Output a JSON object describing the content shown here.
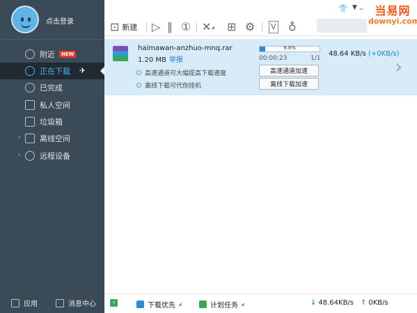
{
  "sidebar": {
    "login": "点击登录",
    "items": [
      {
        "label": "附近",
        "badge": "NEW"
      },
      {
        "label": "正在下载"
      },
      {
        "label": "已完成"
      },
      {
        "label": "私人空间"
      },
      {
        "label": "垃圾箱"
      },
      {
        "label": "离线空间"
      },
      {
        "label": "远程设备"
      }
    ],
    "bottom": {
      "apps": "应用",
      "messages": "消息中心"
    }
  },
  "toolbar": {
    "new_label": "新建",
    "brand_cn": "当易网",
    "brand_en": "downyi.com"
  },
  "download": {
    "file_name": "haimawan-anzhuo-mnq.rar",
    "size": "1.20 MB",
    "report": "举报",
    "progress_text": "9.8%",
    "progress": 0.098,
    "elapsed": "00:00:23",
    "count": "1/1",
    "speed": "48.64 KB/s",
    "speed_up": "(+0KB/s)",
    "tip1": "高速通道可大幅提高下载速度",
    "tip2": "离线下载可代你挂机",
    "btn_high_speed": "高速通道加速",
    "btn_offline": "离线下载加速"
  },
  "status": {
    "priority": "下载优先",
    "schedule": "计划任务",
    "down_speed": "48.64KB/s",
    "up_speed": "0KB/s"
  },
  "colors": {
    "sidebar_bg": "#3a4a56",
    "active_text": "#4fb0f0",
    "row_bg": "#d7ecf8",
    "accent": "#2b8bd6"
  }
}
